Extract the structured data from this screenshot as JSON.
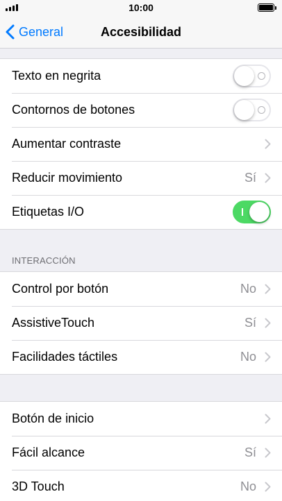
{
  "status_bar": {
    "time": "10:00"
  },
  "nav": {
    "back_label": "General",
    "title": "Accesibilidad"
  },
  "group1": {
    "bold_text": {
      "label": "Texto en negrita",
      "on": false
    },
    "button_shapes": {
      "label": "Contornos de botones",
      "on": false
    },
    "increase_contrast": {
      "label": "Aumentar contraste"
    },
    "reduce_motion": {
      "label": "Reducir movimiento",
      "value": "Sí"
    },
    "onoff_labels": {
      "label": "Etiquetas I/O",
      "on": true
    }
  },
  "interaction": {
    "header": "INTERACCIÓN",
    "switch_control": {
      "label": "Control por botón",
      "value": "No"
    },
    "assistive_touch": {
      "label": "AssistiveTouch",
      "value": "Sí"
    },
    "touch_accommodations": {
      "label": "Facilidades táctiles",
      "value": "No"
    }
  },
  "group3": {
    "home_button": {
      "label": "Botón de inicio"
    },
    "reachability": {
      "label": "Fácil alcance",
      "value": "Sí"
    },
    "touch_3d": {
      "label": "3D Touch",
      "value": "No"
    }
  },
  "colors": {
    "accent": "#007aff",
    "toggle_on": "#4cd964",
    "secondary_text": "#8e8e93"
  },
  "icons": [
    "signal-icon",
    "battery-icon",
    "chevron-left-icon",
    "chevron-right-icon"
  ]
}
